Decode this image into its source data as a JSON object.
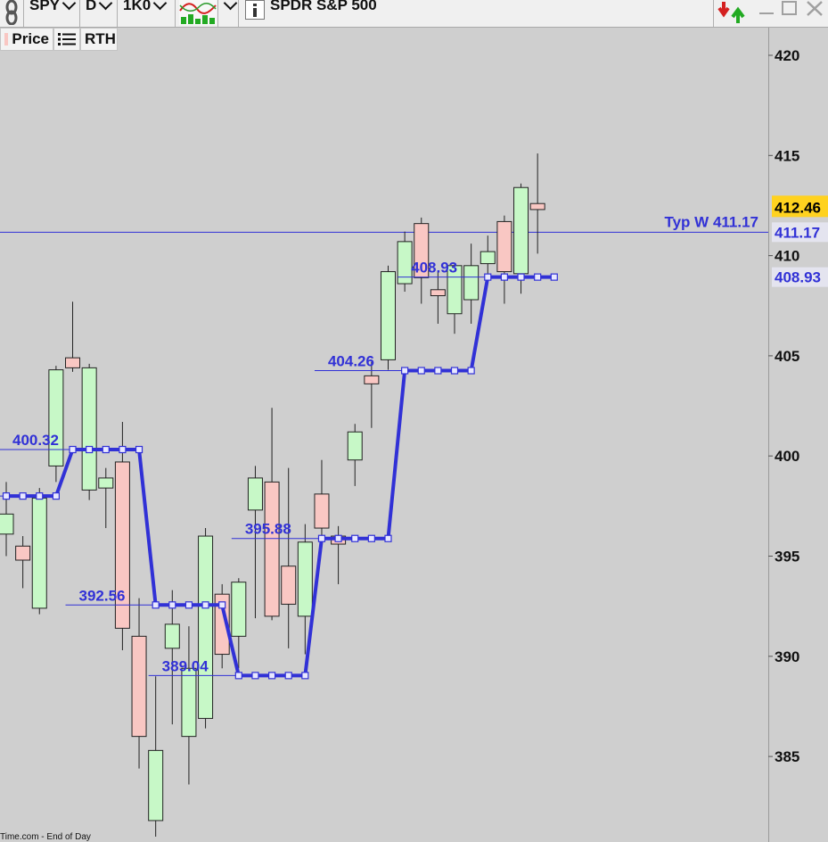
{
  "toolbar": {
    "symbol": "SPY",
    "interval": "D",
    "size": "1K0",
    "name": "SPDR S&P 500"
  },
  "subbar": {
    "price": "Price",
    "rth": "RTH"
  },
  "footer": "Time.com - End of Day",
  "colors": {
    "up": "#c7f8c7",
    "down": "#f9c7c3",
    "typ": "#3131d6",
    "last_badge": "#ffd21f"
  },
  "chart_data": {
    "type": "candlestick",
    "y_range": [
      381,
      423
    ],
    "y_ticks": [
      "420",
      "415",
      "410",
      "405",
      "400",
      "395",
      "390",
      "385"
    ],
    "candles": [
      {
        "o": 396.1,
        "h": 398.7,
        "l": 395.0,
        "c": 397.1
      },
      {
        "o": 395.5,
        "h": 396.0,
        "l": 393.4,
        "c": 394.8
      },
      {
        "o": 392.4,
        "h": 398.4,
        "l": 392.1,
        "c": 397.9
      },
      {
        "o": 399.5,
        "h": 404.5,
        "l": 398.7,
        "c": 404.3
      },
      {
        "o": 404.9,
        "h": 407.7,
        "l": 404.2,
        "c": 404.4
      },
      {
        "o": 398.3,
        "h": 404.6,
        "l": 397.8,
        "c": 404.4
      },
      {
        "o": 398.4,
        "h": 399.4,
        "l": 396.4,
        "c": 398.9
      },
      {
        "o": 399.7,
        "h": 401.7,
        "l": 390.3,
        "c": 391.4
      },
      {
        "o": 391.0,
        "h": 392.9,
        "l": 384.4,
        "c": 386.0
      },
      {
        "o": 381.8,
        "h": 389.0,
        "l": 381.0,
        "c": 385.3
      },
      {
        "o": 390.4,
        "h": 393.3,
        "l": 386.6,
        "c": 391.6
      },
      {
        "o": 386.0,
        "h": 391.5,
        "l": 383.6,
        "c": 389.4
      },
      {
        "o": 386.9,
        "h": 396.4,
        "l": 386.4,
        "c": 396.0
      },
      {
        "o": 393.1,
        "h": 393.6,
        "l": 389.4,
        "c": 390.1
      },
      {
        "o": 391.0,
        "h": 393.9,
        "l": 389.4,
        "c": 393.7
      },
      {
        "o": 397.3,
        "h": 399.5,
        "l": 391.9,
        "c": 398.9
      },
      {
        "o": 398.7,
        "h": 402.4,
        "l": 391.8,
        "c": 392.0
      },
      {
        "o": 394.5,
        "h": 399.4,
        "l": 390.4,
        "c": 392.6
      },
      {
        "o": 392.0,
        "h": 396.6,
        "l": 390.1,
        "c": 395.7
      },
      {
        "o": 398.1,
        "h": 399.8,
        "l": 395.9,
        "c": 396.4
      },
      {
        "o": 396.0,
        "h": 396.5,
        "l": 393.6,
        "c": 395.6
      },
      {
        "o": 399.8,
        "h": 401.6,
        "l": 398.5,
        "c": 401.2
      },
      {
        "o": 404.0,
        "h": 404.7,
        "l": 401.4,
        "c": 403.6
      },
      {
        "o": 404.8,
        "h": 409.5,
        "l": 404.3,
        "c": 409.2
      },
      {
        "o": 408.6,
        "h": 411.2,
        "l": 408.2,
        "c": 410.7
      },
      {
        "o": 411.6,
        "h": 411.9,
        "l": 407.6,
        "c": 408.9
      },
      {
        "o": 408.3,
        "h": 409.2,
        "l": 406.6,
        "c": 408.0
      },
      {
        "o": 407.1,
        "h": 409.6,
        "l": 406.1,
        "c": 409.5
      },
      {
        "o": 407.8,
        "h": 410.6,
        "l": 406.6,
        "c": 409.5
      },
      {
        "o": 409.6,
        "h": 411.0,
        "l": 409.1,
        "c": 410.2
      },
      {
        "o": 411.7,
        "h": 412.0,
        "l": 407.6,
        "c": 409.2
      },
      {
        "o": 409.1,
        "h": 413.6,
        "l": 408.1,
        "c": 413.4
      },
      {
        "o": 412.6,
        "h": 415.1,
        "l": 410.1,
        "c": 412.3
      }
    ],
    "typ_steps": [
      {
        "value": 398.0,
        "from": 0,
        "to": 3,
        "line_from": 0
      },
      {
        "value": 400.32,
        "from": 4,
        "to": 8,
        "line_from": 0,
        "label": "400.32"
      },
      {
        "value": 392.56,
        "from": 9,
        "to": 13,
        "line_from": 4,
        "label": "392.56"
      },
      {
        "value": 389.04,
        "from": 14,
        "to": 18,
        "line_from": 9,
        "label": "389.04"
      },
      {
        "value": 395.88,
        "from": 19,
        "to": 23,
        "line_from": 14,
        "label": "395.88"
      },
      {
        "value": 404.26,
        "from": 24,
        "to": 28,
        "line_from": 19,
        "label": "404.26"
      },
      {
        "value": 408.93,
        "from": 29,
        "to": 33,
        "line_from": 24,
        "label": "408.93"
      }
    ],
    "typ_label": "Typ W 411.17",
    "typ_value": 411.17,
    "last_price": "412.46",
    "last_value": 412.46,
    "badge_typ": "411.17",
    "badge_level": "408.93",
    "badge_level_value": 408.93
  }
}
